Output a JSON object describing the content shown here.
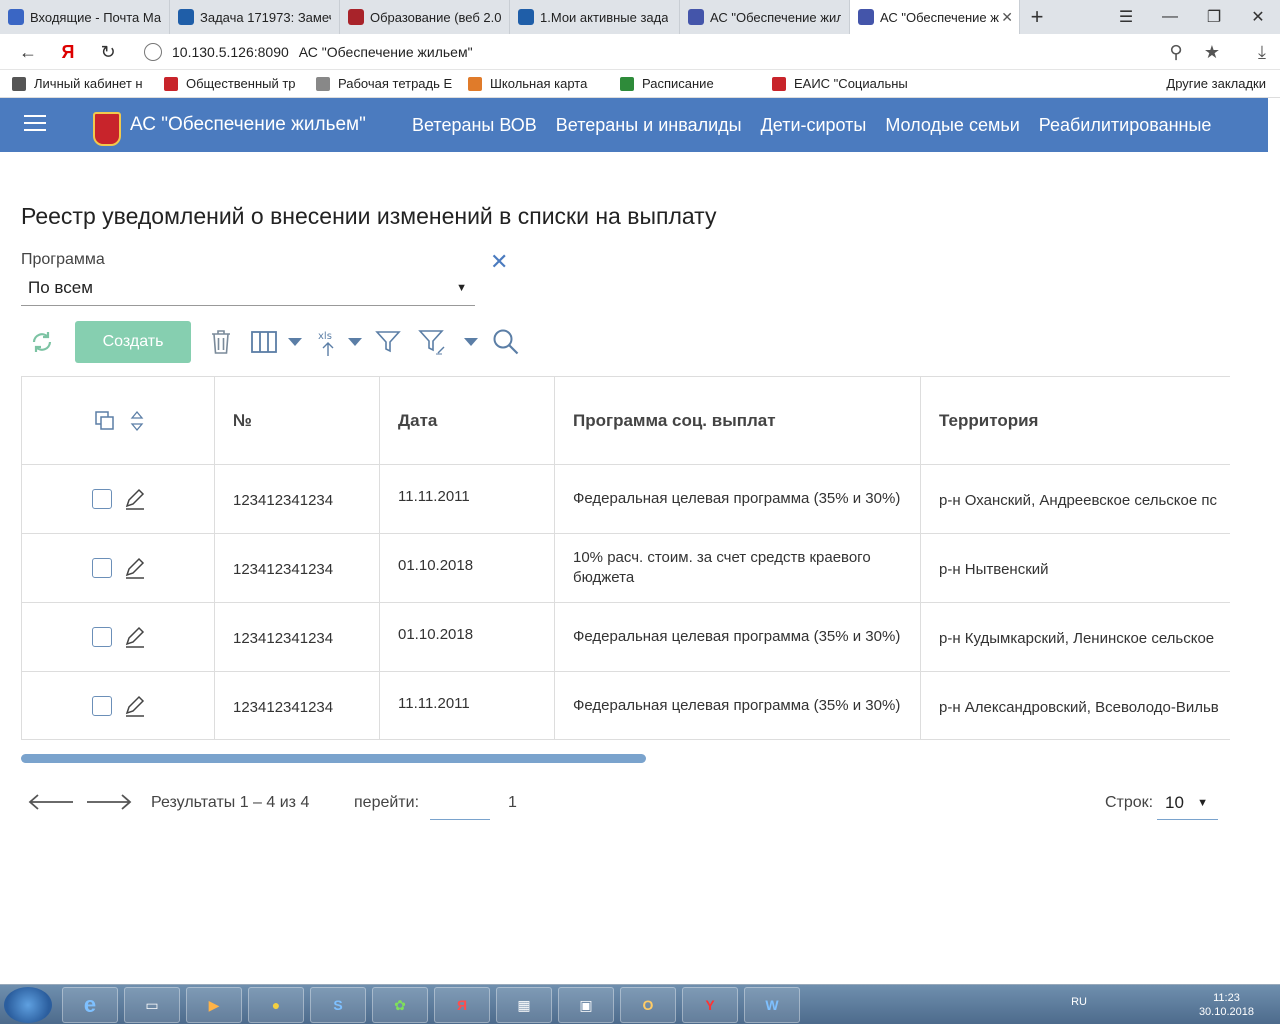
{
  "browser": {
    "tabs": [
      {
        "title": "Входящие - Почта Ма",
        "icon_color": "#3a66c4",
        "active": false
      },
      {
        "title": "Задача 171973: Замеч",
        "icon_color": "#1f5ea8",
        "active": false
      },
      {
        "title": "Образование (веб 2.0",
        "icon_color": "#a8232a",
        "active": false
      },
      {
        "title": "1.Мои активные зада",
        "icon_color": "#1f5ea8",
        "active": false
      },
      {
        "title": "АС \"Обеспечение жил",
        "icon_color": "#4455aa",
        "active": false
      },
      {
        "title": "АС \"Обеспечение ж",
        "icon_color": "#4455aa",
        "active": true
      }
    ],
    "address": {
      "host": "10.130.5.126:8090",
      "page_title": "АС \"Обеспечение жильем\""
    },
    "bookmarks": [
      {
        "label": "Личный кабинет н",
        "icon_color": "#555555"
      },
      {
        "label": "Общественный тр",
        "icon_color": "#c8242b"
      },
      {
        "label": "Рабочая тетрадь Е",
        "icon_color": "#888888"
      },
      {
        "label": "Школьная карта",
        "icon_color": "#e07b2a"
      },
      {
        "label": "Расписание",
        "icon_color": "#2e8b3a"
      },
      {
        "label": "ЕАИС \"Социальны",
        "icon_color": "#c8242b"
      }
    ],
    "other_bookmarks": "Другие закладки"
  },
  "app": {
    "name": "АС \"Обеспечение жильем\"",
    "nav": [
      "Ветераны ВОВ",
      "Ветераны и инвалиды",
      "Дети-сироты",
      "Молодые семьи",
      "Реабилитированные"
    ]
  },
  "page": {
    "title": "Реестр уведомлений о внесении изменений в списки на выплату",
    "filter": {
      "label": "Программа",
      "value": "По всем"
    },
    "toolbar": {
      "create_label": "Создать"
    },
    "table": {
      "headers": {
        "number": "№",
        "date": "Дата",
        "program": "Программа соц. выплат",
        "territory": "Территория"
      },
      "rows": [
        {
          "number": "123412341234",
          "date": "11.11.2011",
          "program": "Федеральная целевая программа (35% и 30%)",
          "territory": "р-н Оханский, Андреевское сельское пс"
        },
        {
          "number": "123412341234",
          "date": "01.10.2018",
          "program": "10% расч. стоим. за счет средств краевого бюджета",
          "territory": "р-н Нытвенский"
        },
        {
          "number": "123412341234",
          "date": "01.10.2018",
          "program": "Федеральная целевая программа (35% и 30%)",
          "territory": "р-н Кудымкарский, Ленинское сельское"
        },
        {
          "number": "123412341234",
          "date": "11.11.2011",
          "program": "Федеральная целевая программа (35% и 30%)",
          "territory": "р-н Александровский, Всеволодо-Вильв"
        }
      ]
    },
    "pager": {
      "results": "Результаты 1 – 4 из 4",
      "goto_label": "перейти:",
      "page": "1",
      "rows_label": "Строк:",
      "rows_value": "10"
    }
  },
  "taskbar": {
    "lang": "RU",
    "time": "11:23",
    "date": "30.10.2018"
  }
}
